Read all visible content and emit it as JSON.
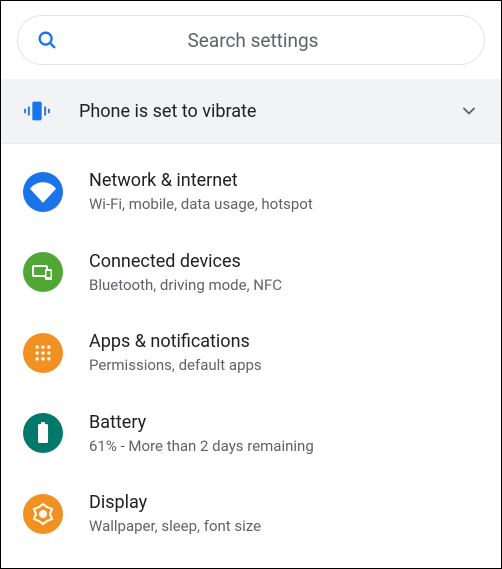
{
  "search": {
    "placeholder": "Search settings"
  },
  "banner": {
    "text": "Phone is set to vibrate"
  },
  "items": [
    {
      "title": "Network & internet",
      "subtitle": "Wi-Fi, mobile, data usage, hotspot"
    },
    {
      "title": "Connected devices",
      "subtitle": "Bluetooth, driving mode, NFC"
    },
    {
      "title": "Apps & notifications",
      "subtitle": "Permissions, default apps"
    },
    {
      "title": "Battery",
      "subtitle": "61% - More than 2 days remaining"
    },
    {
      "title": "Display",
      "subtitle": "Wallpaper, sleep, font size"
    }
  ]
}
